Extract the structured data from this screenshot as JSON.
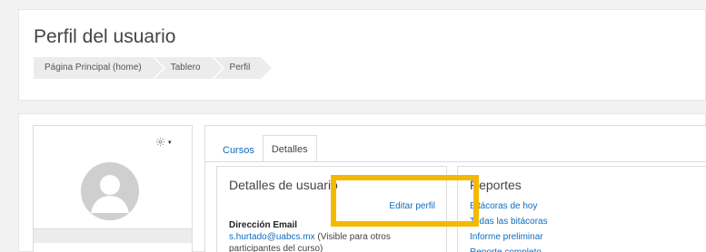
{
  "header": {
    "title": "Perfil del usuario",
    "breadcrumb": [
      "Página Principal (home)",
      "Tablero",
      "Perfil"
    ]
  },
  "user_panel": {
    "gear_icon": "gear-icon",
    "menu_caret": "▾"
  },
  "tabs": [
    {
      "label": "Cursos",
      "active": false
    },
    {
      "label": "Detalles",
      "active": true
    }
  ],
  "details": {
    "title": "Detalles de usuario",
    "edit_link": "Editar perfil",
    "email_label": "Dirección Email",
    "email": "s.hurtado@uabcs.mx",
    "email_note": " (Visible para otros participantes del curso)"
  },
  "reports": {
    "title": "Reportes",
    "items": [
      "Bitácoras de hoy",
      "Todas las bitácoras",
      "Informe preliminar",
      "Reporte completo"
    ]
  },
  "colors": {
    "link": "#0f6cbf",
    "highlight": "#f5b800"
  }
}
